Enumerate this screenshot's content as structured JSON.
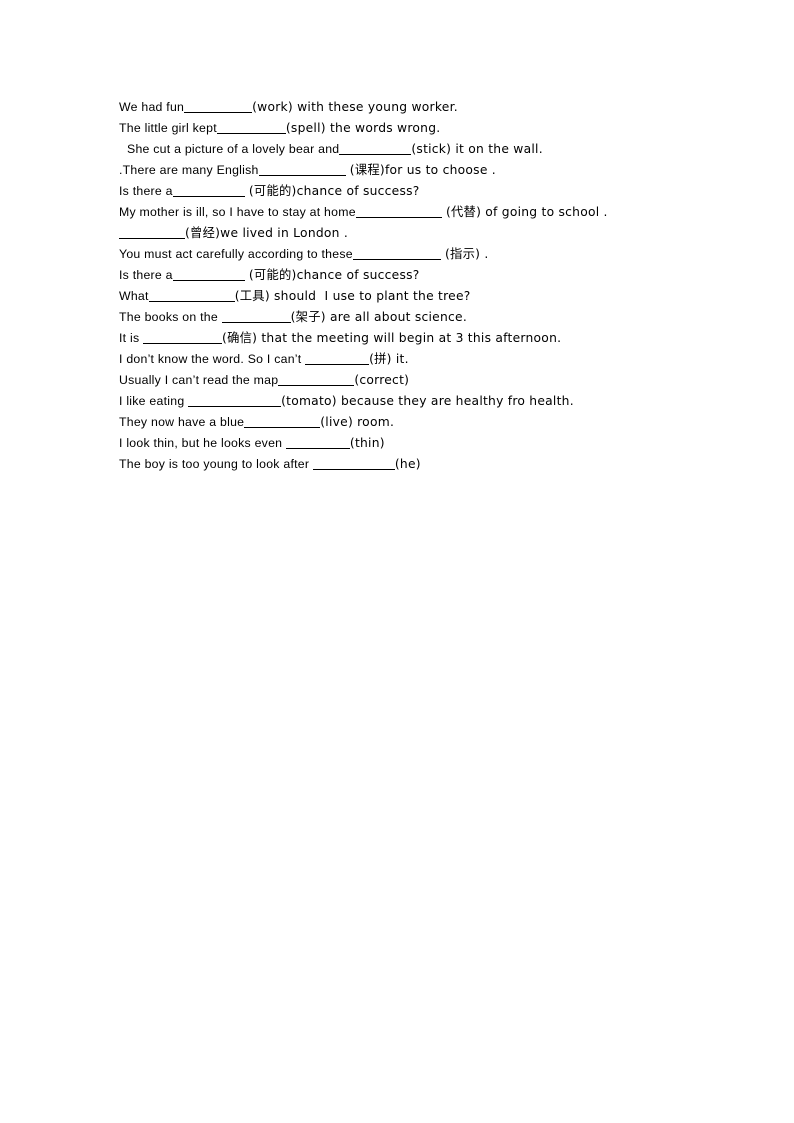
{
  "document": {
    "type": "worksheet",
    "title": "English word-form fill-in-the-blank exercise",
    "background_color": "#ffffff",
    "text_color": "#000000",
    "lines": [
      {
        "id": "q1",
        "indent": false,
        "before": "We had fun",
        "blank_width": 68,
        "after": "(work) with these young worker."
      },
      {
        "id": "q2",
        "indent": false,
        "before": "The little girl kept",
        "blank_width": 69,
        "after": "(spell) the words wrong."
      },
      {
        "id": "q3",
        "indent": true,
        "before": "She cut a picture of a lovely bear and",
        "blank_width": 72,
        "after": "(stick) it on the wall."
      },
      {
        "id": "q4",
        "indent": false,
        "before": ".There are many English",
        "blank_width": 87,
        "after": " (课程)for us to choose ."
      },
      {
        "id": "q5",
        "indent": false,
        "before": "Is there a",
        "blank_width": 72,
        "after": " (可能的)chance of success?"
      },
      {
        "id": "q6",
        "indent": false,
        "before": "My mother is ill, so I have to stay at home",
        "blank_width": 86,
        "after": " (代替) of going to school ."
      },
      {
        "id": "q7",
        "indent": false,
        "before": "",
        "blank_width": 66,
        "after": "(曾经)we lived in London ."
      },
      {
        "id": "q8",
        "indent": false,
        "before": "You must act carefully according to these",
        "blank_width": 88,
        "after": " (指示) ."
      },
      {
        "id": "q9",
        "indent": false,
        "before": "Is there a",
        "blank_width": 72,
        "after": " (可能的)chance of success?"
      },
      {
        "id": "q10",
        "indent": false,
        "before": "What",
        "blank_width": 86,
        "after": "(工具) should  I use to plant the tree?"
      },
      {
        "id": "q11",
        "indent": false,
        "before": "The books on the ",
        "blank_width": 69,
        "after": "(架子) are all about science."
      },
      {
        "id": "q12",
        "indent": false,
        "before": "It is ",
        "blank_width": 79,
        "after": "(确信) that the meeting will begin at 3 this afternoon."
      },
      {
        "id": "q13",
        "indent": false,
        "before": "I don’t know the word. So I can’t ",
        "blank_width": 64,
        "after": "(拼) it."
      },
      {
        "id": "q14",
        "indent": false,
        "before": "Usually I can’t read the map",
        "blank_width": 76,
        "after": "(correct)"
      },
      {
        "id": "q15",
        "indent": false,
        "before": "I like eating ",
        "blank_width": 93,
        "after": "(tomato) because they are healthy fro health."
      },
      {
        "id": "q16",
        "indent": false,
        "before": "They now have a blue",
        "blank_width": 76,
        "after": "(live) room."
      },
      {
        "id": "q17",
        "indent": false,
        "before": "I look thin, but he looks even ",
        "blank_width": 64,
        "after": "(thin)"
      },
      {
        "id": "q18",
        "indent": false,
        "before": "The boy is too young to look after ",
        "blank_width": 82,
        "after": "(he)"
      }
    ]
  }
}
